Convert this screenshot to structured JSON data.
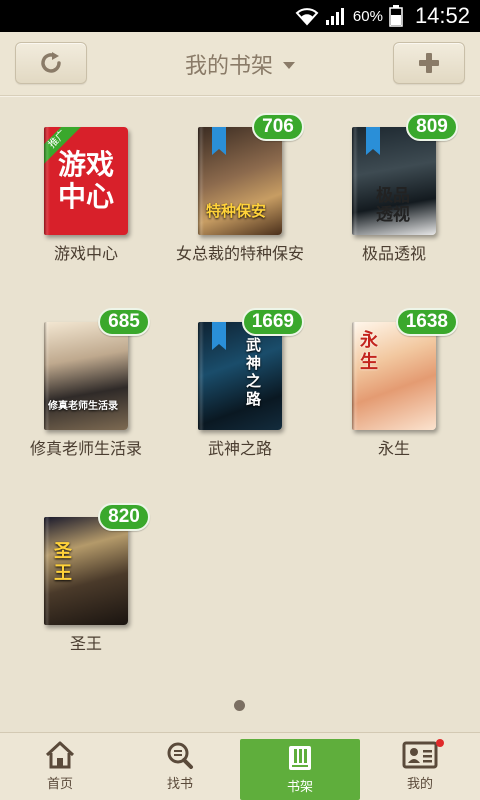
{
  "status_bar": {
    "battery_percent": "60%",
    "time": "14:52"
  },
  "header": {
    "title": "我的书架",
    "refresh_icon": "refresh-icon",
    "add_icon": "plus-icon"
  },
  "books": [
    {
      "title": "游戏中心",
      "badge": "",
      "cover_text_line1": "游戏",
      "cover_text_line2": "中心",
      "promo": "推广"
    },
    {
      "title": "女总裁的特种保安",
      "badge": "706",
      "cover_text": "特种保安"
    },
    {
      "title": "极品透视",
      "badge": "809",
      "cover_text": "极品透视"
    },
    {
      "title": "修真老师生活录",
      "badge": "685",
      "cover_text": "修真老师生活录"
    },
    {
      "title": "武神之路",
      "badge": "1669",
      "cover_text": "武神之路"
    },
    {
      "title": "永生",
      "badge": "1638",
      "cover_text": "永生"
    },
    {
      "title": "圣王",
      "badge": "820",
      "cover_text": "圣王"
    }
  ],
  "bottom_nav": {
    "items": [
      {
        "label": "首页",
        "icon": "home-icon"
      },
      {
        "label": "找书",
        "icon": "search-book-icon"
      },
      {
        "label": "书架",
        "icon": "bookshelf-icon"
      },
      {
        "label": "我的",
        "icon": "profile-card-icon"
      }
    ],
    "active_index": 2
  },
  "colors": {
    "accent_green": "#5fae3c",
    "badge_green": "#3aa82c",
    "background": "#e9e2d0"
  }
}
